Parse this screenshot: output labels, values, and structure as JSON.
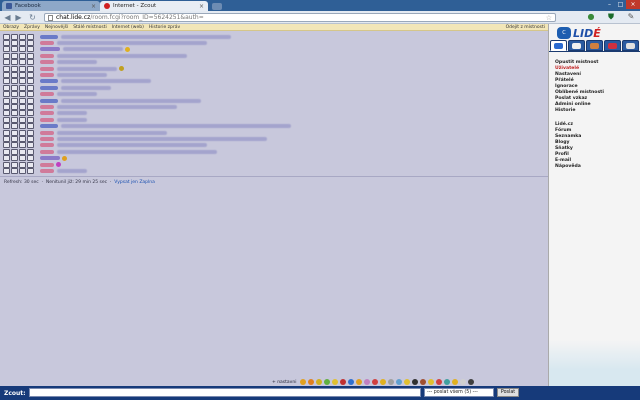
{
  "browser": {
    "tabs": [
      {
        "title": "Facebook",
        "icon": "facebook-icon",
        "color": "#3b5998"
      },
      {
        "title": "Internet - Zcout",
        "icon": "lide-icon",
        "color": "#d02020"
      }
    ],
    "url_host": "chat.lide.cz",
    "url_rest": "/room.fcgi?room_ID=5624251&auth="
  },
  "chat_menu": {
    "items": [
      "Obrazy",
      "Zprávy",
      "Nejnovější",
      "Stálé místnosti",
      "Internet (web)",
      "Historie zpráv"
    ],
    "right": "Odejít z místnosti"
  },
  "messages": [
    {
      "nick": "blue",
      "nw": 18,
      "tw": 170,
      "emo": ""
    },
    {
      "nick": "red",
      "nw": 14,
      "tw": 150,
      "emo": ""
    },
    {
      "nick": "purple",
      "nw": 20,
      "tw": 60,
      "emo": "#e0b020"
    },
    {
      "nick": "red",
      "nw": 14,
      "tw": 130,
      "emo": ""
    },
    {
      "nick": "red",
      "nw": 14,
      "tw": 40,
      "emo": ""
    },
    {
      "nick": "red",
      "nw": 14,
      "tw": 60,
      "emo": "#c0a020"
    },
    {
      "nick": "red",
      "nw": 14,
      "tw": 50,
      "emo": ""
    },
    {
      "nick": "blue",
      "nw": 18,
      "tw": 90,
      "emo": ""
    },
    {
      "nick": "blue",
      "nw": 18,
      "tw": 50,
      "emo": ""
    },
    {
      "nick": "red",
      "nw": 14,
      "tw": 40,
      "emo": ""
    },
    {
      "nick": "blue",
      "nw": 18,
      "tw": 140,
      "emo": ""
    },
    {
      "nick": "red",
      "nw": 14,
      "tw": 120,
      "emo": ""
    },
    {
      "nick": "red",
      "nw": 14,
      "tw": 30,
      "emo": ""
    },
    {
      "nick": "red",
      "nw": 14,
      "tw": 30,
      "emo": ""
    },
    {
      "nick": "blue",
      "nw": 18,
      "tw": 230,
      "emo": ""
    },
    {
      "nick": "red",
      "nw": 14,
      "tw": 110,
      "emo": ""
    },
    {
      "nick": "red",
      "nw": 14,
      "tw": 210,
      "emo": ""
    },
    {
      "nick": "red",
      "nw": 14,
      "tw": 150,
      "emo": ""
    },
    {
      "nick": "red",
      "nw": 14,
      "tw": 160,
      "emo": ""
    },
    {
      "nick": "purple",
      "nw": 20,
      "tw": 0,
      "emo": "#e0a020"
    },
    {
      "nick": "red",
      "nw": 14,
      "tw": 0,
      "emo": "#c040c0"
    },
    {
      "nick": "red",
      "nw": 14,
      "tw": 30,
      "emo": ""
    }
  ],
  "status": {
    "refresh": "Refresh: 30 sec",
    "idle": "Nenítunil již: 29 min 25 sec",
    "link": "Vypsat jen Zaplna"
  },
  "smileys": {
    "label": "+ nastavni",
    "colors": [
      "#e0a020",
      "#e08020",
      "#d0b020",
      "#60b040",
      "#e0c030",
      "#c03030",
      "#3070d0",
      "#e0a020",
      "#c080c0",
      "#d04040",
      "#e0b020",
      "#a0a0a0",
      "#60a0d0",
      "#e0c030",
      "#303030",
      "#a05030",
      "#e0c030",
      "#d04040",
      "#40a0a0",
      "#e0b020",
      "#d0d0d0",
      "#404040"
    ]
  },
  "sidebar": {
    "logo_badge": "C",
    "logo_word_a": "LID",
    "logo_word_b": "É",
    "menu_a": [
      "Opustit místnost",
      "Uživatelé",
      "Nastavení",
      "Přátelé",
      "Ignorace",
      "Oblíbené místnosti",
      "Poslat vzkaz",
      "Admini online",
      "Historie"
    ],
    "menu_b": [
      "Lidé.cz",
      "Fórum",
      "Seznamka",
      "Blogy",
      "Sňatky",
      "Profil",
      "E-mail",
      "Nápověda"
    ]
  },
  "input_bar": {
    "label": "Zcout:",
    "select_value": "--- poslat všem (5) ---",
    "send": "Poslat"
  }
}
